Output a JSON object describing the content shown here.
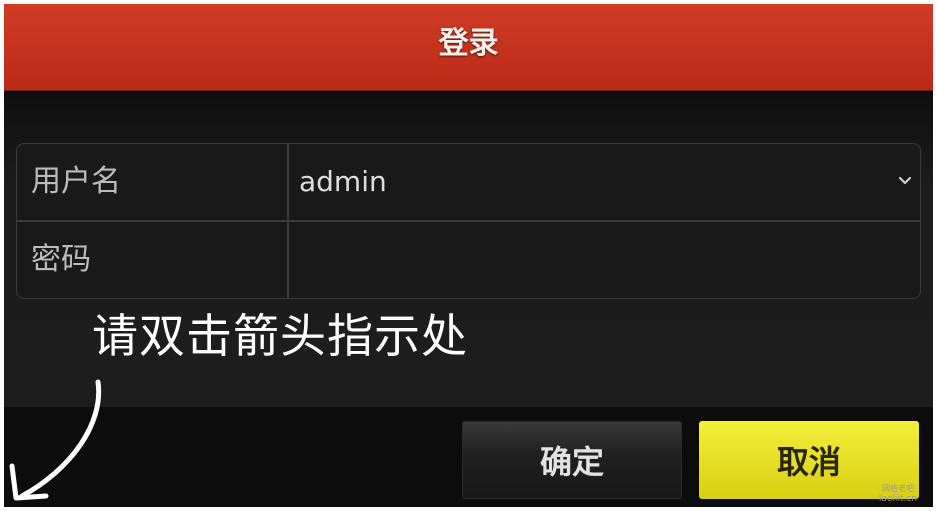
{
  "dialog": {
    "title": "登录"
  },
  "form": {
    "username": {
      "label": "用户名",
      "value": "admin"
    },
    "password": {
      "label": "密码",
      "value": ""
    }
  },
  "buttons": {
    "ok_label": "确定",
    "cancel_label": "取消"
  },
  "annotation": {
    "instruction": "请双击箭头指示处"
  },
  "watermark": {
    "line1": "网络老吧",
    "line2": "laoliit.cn"
  },
  "colors": {
    "title_bar": "#c9341f",
    "dialog_bg": "#161616",
    "cancel_button": "#e9e224",
    "ok_button": "#242424"
  },
  "icons": {
    "dropdown": "chevron-down-icon",
    "pointer": "curved-arrow-icon"
  }
}
